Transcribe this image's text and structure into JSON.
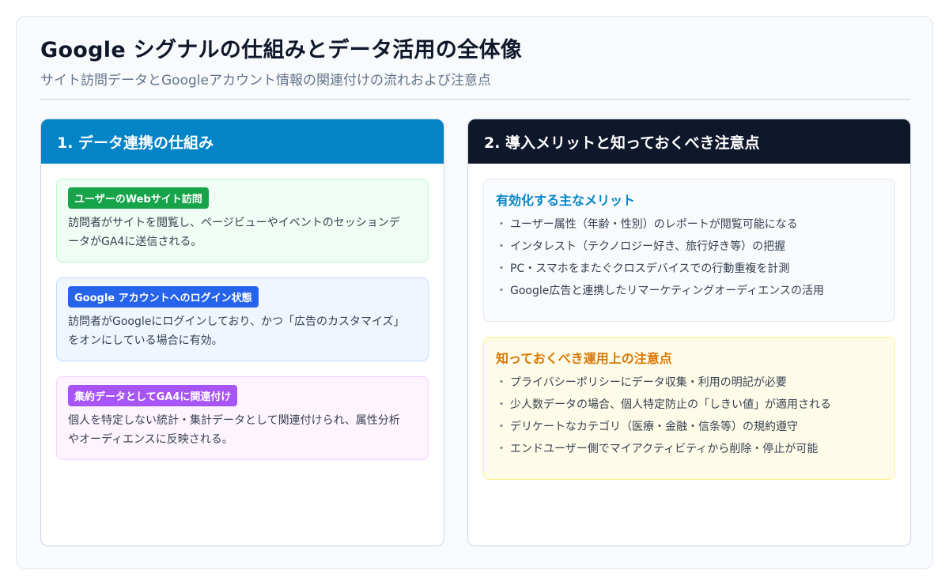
{
  "header": {
    "title": "Google シグナルの仕組みとデータ活用の全体像",
    "subtitle": "サイト訪問データとGoogleアカウント情報の関連付けの流れおよび注意点"
  },
  "left_panel": {
    "heading": "1. データ連携の仕組み",
    "steps": [
      {
        "badge": "ユーザーのWebサイト訪問",
        "text": "訪問者がサイトを閲覧し、ページビューやイベントのセッションデータがGA4に送信される。"
      },
      {
        "badge": "Google アカウントへのログイン状態",
        "text": "訪問者がGoogleにログインしており、かつ「広告のカスタマイズ」をオンにしている場合に有効。"
      },
      {
        "badge": "集約データとしてGA4に関連付け",
        "text": "個人を特定しない統計・集計データとして関連付けられ、属性分析やオーディエンスに反映される。"
      }
    ]
  },
  "right_panel": {
    "heading": "2. 導入メリットと知っておくべき注意点",
    "merits": {
      "title": "有効化する主なメリット",
      "items": [
        "ユーザー属性（年齢・性別）のレポートが閲覧可能になる",
        "インタレスト（テクノロジー好き、旅行好き等）の把握",
        "PC・スマホをまたぐクロスデバイスでの行動重複を計測",
        "Google広告と連携したリマーケティングオーディエンスの活用"
      ]
    },
    "cautions": {
      "title": "知っておくべき運用上の注意点",
      "items": [
        "プライバシーポリシーにデータ収集・利用の明記が必要",
        "少人数データの場合、個人特定防止の「しきい値」が適用される",
        "デリケートなカテゴリ（医療・金融・信条等）の規約遵守",
        "エンドユーザー側でマイアクティビティから削除・停止が可能"
      ]
    }
  },
  "bullet": "・",
  "colors": {
    "left_header": "#0284c7",
    "right_header": "#0f172a",
    "step1": "#16a34a",
    "step2": "#2563eb",
    "step3": "#a855f7",
    "merits_title": "#0284c7",
    "cautions_title": "#d97706"
  }
}
